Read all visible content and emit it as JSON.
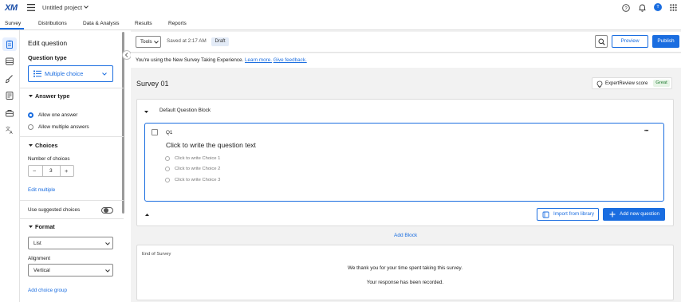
{
  "header": {
    "logo": "XM",
    "project_name": "Untitled project",
    "avatar_initial": "T"
  },
  "tabs": [
    {
      "label": "Survey",
      "active": true
    },
    {
      "label": "Distributions"
    },
    {
      "label": "Data & Analysis"
    },
    {
      "label": "Results"
    },
    {
      "label": "Reports"
    }
  ],
  "rail_icons": [
    "survey-icon",
    "layout-icon",
    "paint-brush-icon",
    "survey-options-icon",
    "tools-icon",
    "translate-icon"
  ],
  "edit_panel": {
    "title": "Edit question",
    "question_type_label": "Question type",
    "question_type_value": "Multiple choice",
    "answer_type_heading": "Answer type",
    "answer_options": [
      "Allow one answer",
      "Allow multiple answers"
    ],
    "selected_answer_index": 0,
    "choices_heading": "Choices",
    "number_of_choices_label": "Number of choices",
    "number_of_choices": "3",
    "minus": "−",
    "plus": "+",
    "edit_multiple": "Edit multiple",
    "suggested_choices_label": "Use suggested choices",
    "suggested_choices_on": false,
    "format_heading": "Format",
    "format_value": "List",
    "alignment_label": "Alignment",
    "alignment_value": "Vertical",
    "add_choice_group": "Add choice group"
  },
  "toolbar": {
    "tools_label": "Tools",
    "saved_text": "Saved at 2:17 AM",
    "draft_label": "Draft",
    "preview_label": "Preview",
    "publish_label": "Publish"
  },
  "banner": {
    "text": "You're using the New Survey Taking Experience.",
    "learn_more": "Learn more.",
    "feedback": "Give feedback."
  },
  "survey": {
    "title": "Survey 01",
    "expert_review_label": "ExpertReview score",
    "expert_review_value": "Great",
    "block_title": "Default Question Block",
    "question_number": "Q1",
    "question_text": "Click to write the question text",
    "choices": [
      "Click to write Choice 1",
      "Click to write Choice 2",
      "Click to write Choice 3"
    ],
    "more_label": "•••",
    "import_label": "Import from library",
    "add_question_label": "Add new question",
    "add_block_label": "Add Block",
    "end_label": "End of Survey",
    "end_message_1": "We thank you for your time spent taking this survey.",
    "end_message_2": "Your response has been recorded."
  },
  "colors": {
    "accent": "#1a6de0",
    "great": "#1e7a30"
  }
}
